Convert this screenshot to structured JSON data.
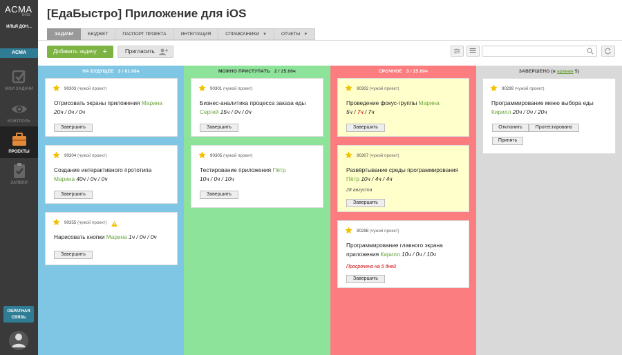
{
  "sidebar": {
    "logo": "ACMA",
    "beta": "beta",
    "user": "ИЛЬЯ ДОН...",
    "badge": "ACMA",
    "items": [
      {
        "label": "МОИ ЗАДАЧИ",
        "icon": "check-icon"
      },
      {
        "label": "КОНТРОЛЬ",
        "icon": "eye-icon"
      },
      {
        "label": "ПРОЕКТЫ",
        "icon": "briefcase-icon"
      },
      {
        "label": "ЗАЯВКИ",
        "icon": "clipboard-icon"
      }
    ],
    "feedback_line1": "ОБРАТНАЯ",
    "feedback_line2": "СВЯЗЬ"
  },
  "page_title": "[ЕдаБыстро] Приложение для iOS",
  "tabs": [
    "ЗАДАЧИ",
    "БЮДЖЕТ",
    "ПАСПОРТ ПРОЕКТА",
    "ИНТЕГРАЦИЯ",
    "СПРАВОЧНИКИ",
    "ОТЧЕТЫ"
  ],
  "toolbar": {
    "add_task": "Добавить задачу",
    "add_plus": "+",
    "invite": "Пригласить",
    "search_placeholder": ""
  },
  "columns": [
    {
      "title": "НА БУДУЩЕЕ",
      "count": "3 / 61.00ч",
      "color": "#7ec6e3",
      "cards": [
        {
          "id": "90303",
          "foreign": "(чужой проект)",
          "line1": "Отрисовать экраны приложения",
          "who1": "Марина",
          "line2": "",
          "who2": "",
          "hours": "20ч / 0ч / 0ч",
          "button": "Завершить"
        },
        {
          "id": "90304",
          "foreign": "(чужой проект)",
          "line1": "Создание интерактивного прототипа",
          "who1": "",
          "line2": "",
          "who2": "Марина",
          "hours": "40ч / 0ч / 0ч",
          "button": "Завершить"
        },
        {
          "id": "90355",
          "foreign": "(чужой проект)",
          "line1": "Нарисовать кнопки",
          "who1": "Марина",
          "hours": "1ч / 0ч / 0ч",
          "button": "Завершить"
        }
      ]
    },
    {
      "title": "МОЖНО ПРИСТУПАТЬ",
      "count": "2 / 25.00ч",
      "color": "#8ee39b",
      "cards": [
        {
          "id": "90301",
          "foreign": "(чужой проект)",
          "line1": "Бизнес-аналитика процесса заказа еды",
          "who2": "Сергей",
          "hours": "15ч / 0ч / 0ч",
          "button": "Завершить"
        },
        {
          "id": "90305",
          "foreign": "(чужой проект)",
          "line1": "Тестирование приложения",
          "who1": "Пётр",
          "hours": "10ч / 0ч / 10ч",
          "button": "Завершить"
        }
      ]
    },
    {
      "title": "СРОЧНОЕ",
      "count": "3 / 25.00ч",
      "color": "#fb7d7f",
      "cards": [
        {
          "id": "90302",
          "foreign": "(чужой проект)",
          "line1": "Проведение фокус-группы",
          "who1": "Марина",
          "h_a": "5ч / ",
          "h_b": "7ч",
          "h_c": " / 7ч",
          "button": "Завершить"
        },
        {
          "id": "90307",
          "foreign": "(чужой проект)",
          "line1": "Развёртывание среды программирования",
          "who2": "Пётр",
          "hours": "10ч / 4ч / 4ч",
          "date": "28 августа",
          "button": "Завершить"
        },
        {
          "id": "90298",
          "foreign": "(чужой проект)",
          "line1": "Программирование главного экрана",
          "line2": "приложения",
          "who2": "Кирилл",
          "hours": "10ч / 0ч / 10ч",
          "overdue": "Просрочено на 5 дней",
          "button": "Завершить"
        }
      ]
    },
    {
      "title_a": "ЗАВЕРШЕНО (в ",
      "title_link": "архиве",
      "title_b": " 5)",
      "color": "#d9d9d9",
      "cards": [
        {
          "id": "90299",
          "foreign": "(чужой проект)",
          "line1": "Программирование меню выбора еды",
          "who2": "Кирилл",
          "hours": "20ч / 0ч / 20ч",
          "btn_reject": "Отклонить",
          "btn_tested": "Протестировано",
          "btn_accept": "Принять"
        }
      ]
    }
  ]
}
